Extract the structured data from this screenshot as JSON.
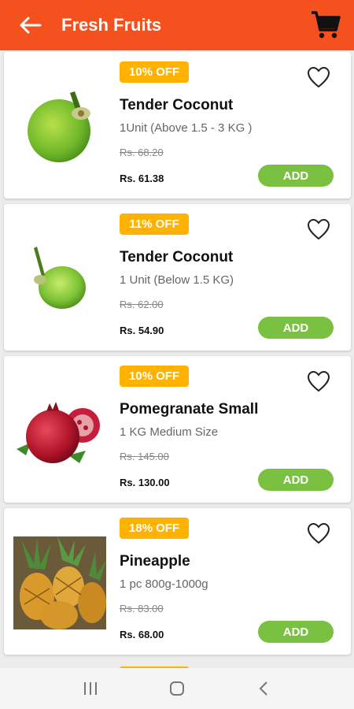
{
  "header": {
    "title": "Fresh Fruits",
    "back_icon": "arrow-left-icon",
    "cart_icon": "cart-icon",
    "accent": "#f4511e"
  },
  "products": [
    {
      "discount": "10% OFF",
      "name": "Tender Coconut",
      "qty": "1Unit (Above 1.5 - 3 KG )",
      "mrp": "Rs. 68.20",
      "price": "Rs. 61.38",
      "add": "ADD",
      "image": "green-coconut"
    },
    {
      "discount": "11% OFF",
      "name": "Tender Coconut",
      "qty": "1 Unit (Below 1.5 KG)",
      "mrp": "Rs. 62.00",
      "price": "Rs. 54.90",
      "add": "ADD",
      "image": "small-green-coconut"
    },
    {
      "discount": "10% OFF",
      "name": "Pomegranate Small",
      "qty": "1 KG Medium Size",
      "mrp": "Rs. 145.00",
      "price": "Rs. 130.00",
      "add": "ADD",
      "image": "pomegranate"
    },
    {
      "discount": "18% OFF",
      "name": "Pineapple",
      "qty": "1 pc 800g-1000g",
      "mrp": "Rs. 83.00",
      "price": "Rs. 68.00",
      "add": "ADD",
      "image": "pineapple"
    }
  ],
  "colors": {
    "badge": "#ffb300",
    "add_button": "#7ac142"
  },
  "navbar": {
    "icons": [
      "recent-apps-icon",
      "home-icon",
      "back-icon"
    ]
  }
}
